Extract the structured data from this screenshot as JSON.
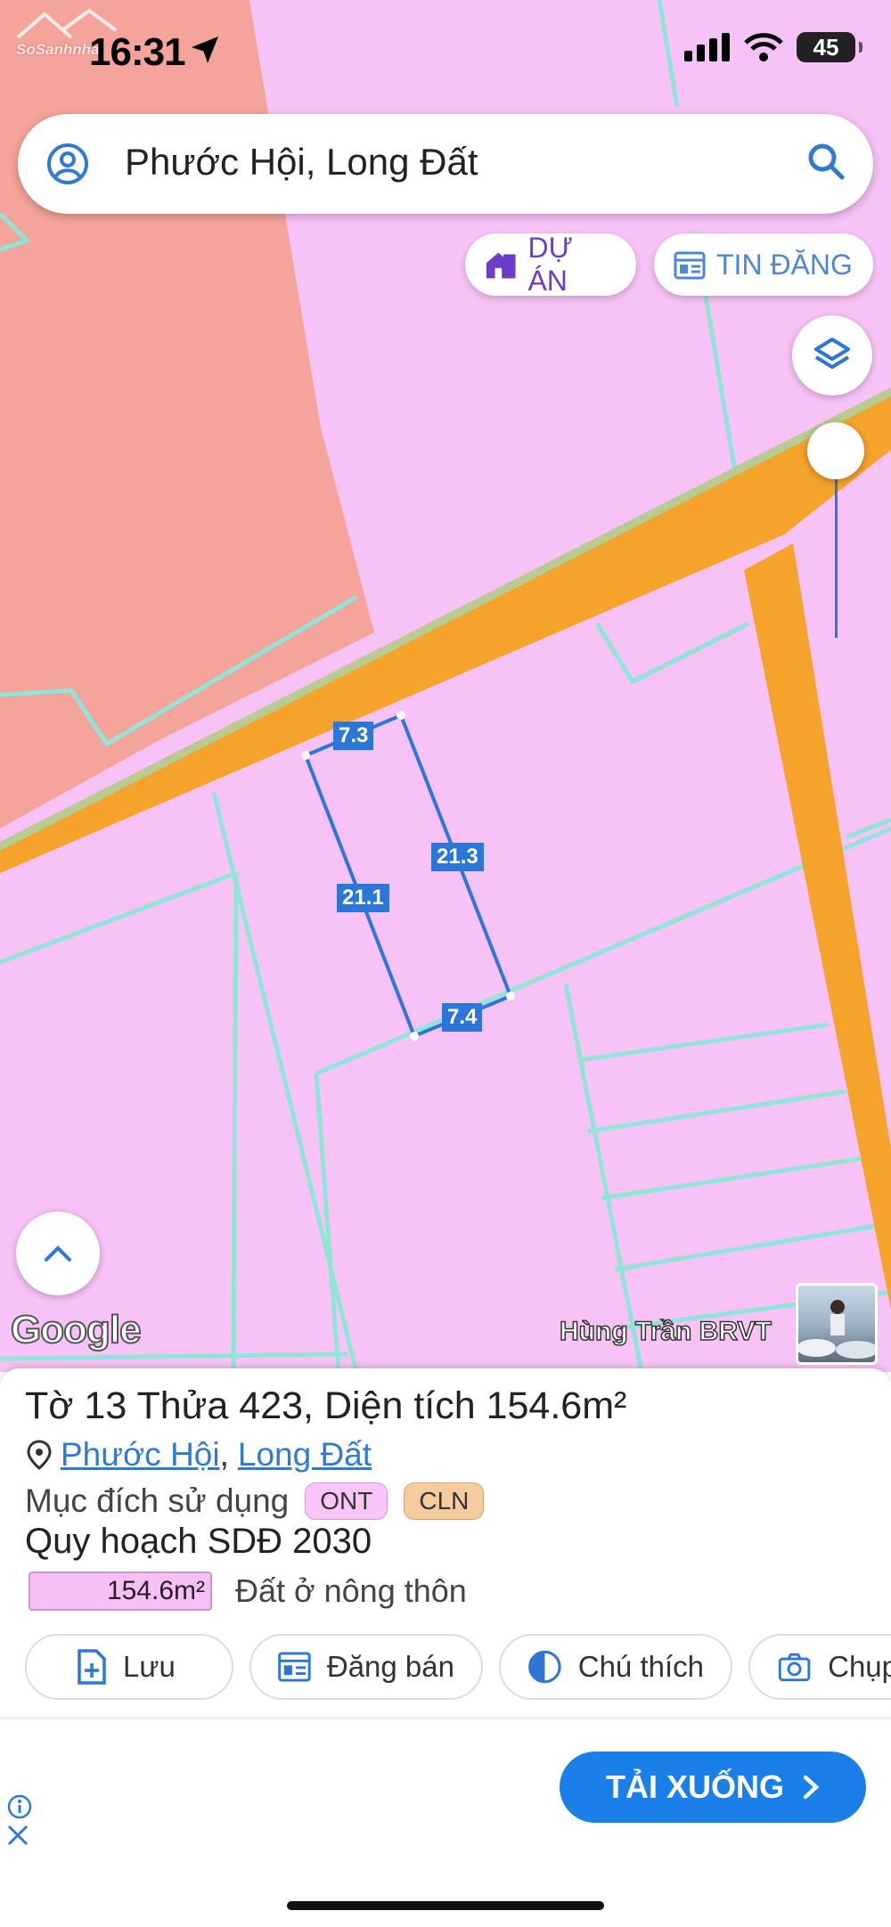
{
  "status": {
    "time": "16:31",
    "battery": "45",
    "watermark": "SoSanhnha"
  },
  "search": {
    "text": "Phước Hội, Long Đất"
  },
  "filters": {
    "project_label": "DỰ ÁN",
    "listing_label": "TIN ĐĂNG"
  },
  "map": {
    "edges": [
      "7.3",
      "21.3",
      "21.1",
      "7.4"
    ],
    "attribution": "Google",
    "author": "Hùng Trần BRVT",
    "colors": {
      "residential": "#f7c2f5",
      "commercial": "#f4a49a",
      "road": "#f5a32a",
      "boundary": "#8fe6d6",
      "parcel": "#2b76d6"
    }
  },
  "parcel": {
    "sheet_label": "Tờ",
    "sheet": "13",
    "plot_label": "Thửa",
    "plot": "423",
    "area_label": "Diện tích",
    "area": "154.6m²",
    "ward": "Phước Hội",
    "district": "Long Đất",
    "purpose_label": "Mục đích sử dụng",
    "purpose_tags": [
      "ONT",
      "CLN"
    ],
    "plan_title": "Quy hoạch SDĐ 2030",
    "plan_area": "154.6m²",
    "plan_desc": "Đất ở nông thôn"
  },
  "actions": {
    "save": "Lưu",
    "sell": "Đăng bán",
    "legend": "Chú thích",
    "capture": "Chụp"
  },
  "ad": {
    "button": "TẢI XUỐNG"
  }
}
